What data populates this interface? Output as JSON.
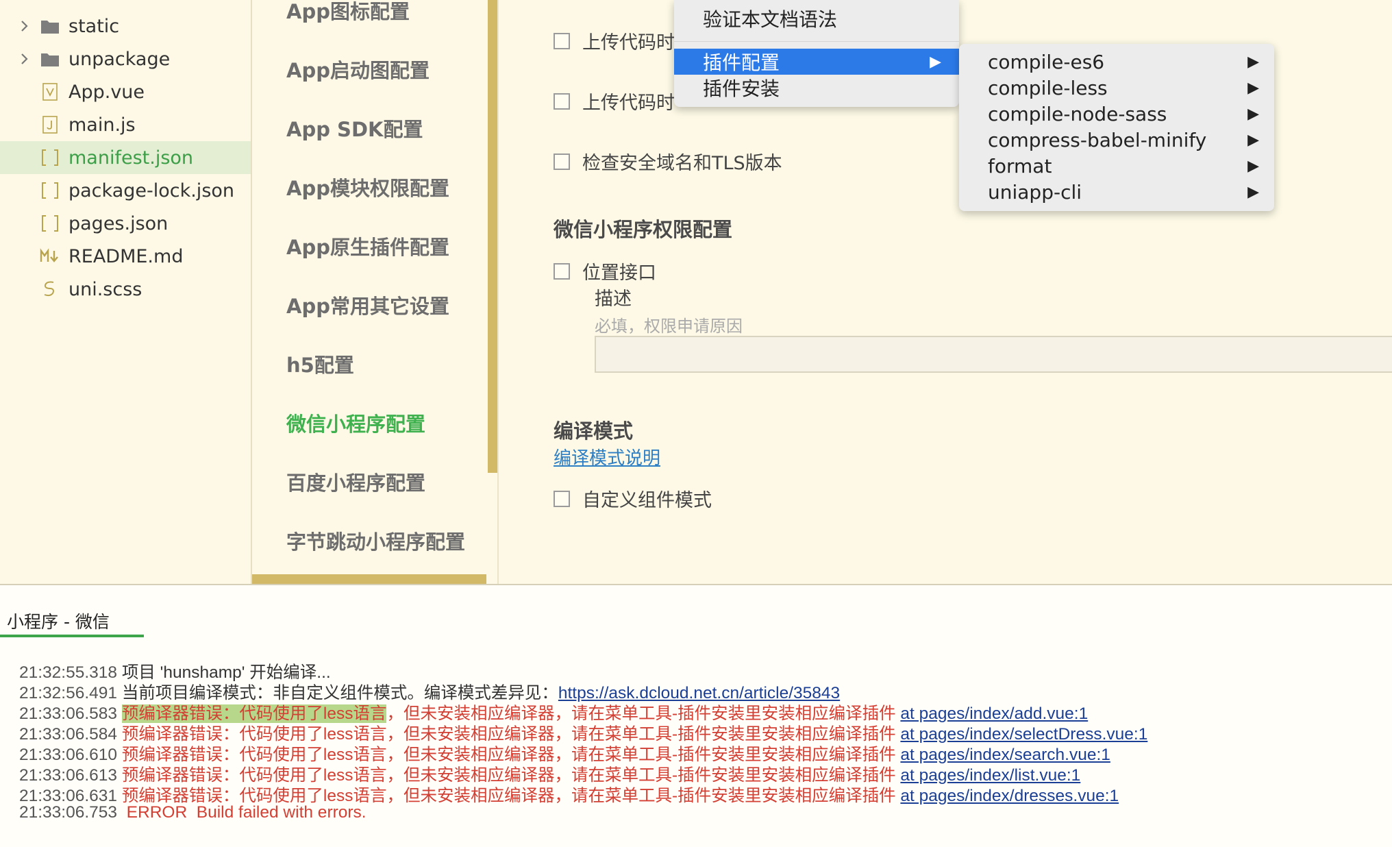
{
  "file_tree": {
    "items": [
      {
        "name": "static",
        "type": "folder",
        "icon": "folder-icon",
        "expandable": true
      },
      {
        "name": "unpackage",
        "type": "folder",
        "icon": "folder-icon",
        "expandable": true
      },
      {
        "name": "App.vue",
        "type": "file",
        "icon": "vue-file-icon"
      },
      {
        "name": "main.js",
        "type": "file",
        "icon": "js-file-icon"
      },
      {
        "name": "manifest.json",
        "type": "file",
        "icon": "json-file-icon",
        "selected": true
      },
      {
        "name": "package-lock.json",
        "type": "file",
        "icon": "json-file-icon"
      },
      {
        "name": "pages.json",
        "type": "file",
        "icon": "json-file-icon"
      },
      {
        "name": "README.md",
        "type": "file",
        "icon": "markdown-file-icon"
      },
      {
        "name": "uni.scss",
        "type": "file",
        "icon": "scss-file-icon"
      }
    ]
  },
  "nav": {
    "items": [
      {
        "label": "App图标配置"
      },
      {
        "label": "App启动图配置"
      },
      {
        "label": "App  SDK配置"
      },
      {
        "label": "App模块权限配置"
      },
      {
        "label": "App原生插件配置"
      },
      {
        "label": "App常用其它设置"
      },
      {
        "label": "h5配置"
      },
      {
        "label": "微信小程序配置",
        "active": true
      },
      {
        "label": "百度小程序配置"
      },
      {
        "label": "字节跳动小程序配置"
      }
    ]
  },
  "content": {
    "checkbox_upload_1": "上传代码时",
    "checkbox_upload_2": "上传代码时",
    "checkbox_domain": "检查安全域名和TLS版本",
    "permission_title": "微信小程序权限配置",
    "checkbox_location": "位置接口",
    "desc_label": "描述",
    "desc_placeholder": "必填，权限申请原因",
    "compile_mode_title": "编译模式",
    "compile_mode_link": "编译模式说明",
    "checkbox_custom_component": "自定义组件模式"
  },
  "menu": {
    "items": [
      {
        "label": "验证本文档语法"
      },
      {
        "label": "插件配置",
        "highlighted": true,
        "submenu": true
      },
      {
        "label": "插件安装"
      }
    ],
    "submenu_items": [
      {
        "label": "compile-es6"
      },
      {
        "label": "compile-less"
      },
      {
        "label": "compile-node-sass"
      },
      {
        "label": "compress-babel-minify"
      },
      {
        "label": "format"
      },
      {
        "label": "uniapp-cli"
      }
    ],
    "submenu_arrow": "▶",
    "highlight_color": "#2b7ae8"
  },
  "console": {
    "tab_label": "小程序 - 微信",
    "lines": [
      {
        "time": "21:32:55.318",
        "msg": "项目 'hunshamp' 开始编译...",
        "kind": "info"
      },
      {
        "time": "21:32:56.491",
        "msg": "当前项目编译模式：非自定义组件模式。编译模式差异见：",
        "link": "https://ask.dcloud.net.cn/article/35843",
        "kind": "info"
      },
      {
        "time": "21:33:06.583",
        "msg_hl": "预编译器错误：代码使用了less语言",
        "msg": "，但未安装相应编译器，请在菜单工具-插件安装里安装相应编译插件",
        "link": "at pages/index/add.vue:1",
        "kind": "error"
      },
      {
        "time": "21:33:06.584",
        "msg": "预编译器错误：代码使用了less语言，但未安装相应编译器，请在菜单工具-插件安装里安装相应编译插件",
        "link": "at pages/index/selectDress.vue:1",
        "kind": "error"
      },
      {
        "time": "21:33:06.610",
        "msg": "预编译器错误：代码使用了less语言，但未安装相应编译器，请在菜单工具-插件安装里安装相应编译插件",
        "link": "at pages/index/search.vue:1",
        "kind": "error"
      },
      {
        "time": "21:33:06.613",
        "msg": "预编译器错误：代码使用了less语言，但未安装相应编译器，请在菜单工具-插件安装里安装相应编译插件",
        "link": "at pages/index/list.vue:1",
        "kind": "error"
      },
      {
        "time": "21:33:06.631",
        "msg": "预编译器错误：代码使用了less语言，但未安装相应编译器，请在菜单工具-插件安装里安装相应编译插件",
        "link": "at pages/index/dresses.vue:1",
        "kind": "error"
      },
      {
        "time": "21:33:06.753",
        "msg": " ERROR  Build failed with errors.",
        "kind": "error"
      }
    ]
  }
}
